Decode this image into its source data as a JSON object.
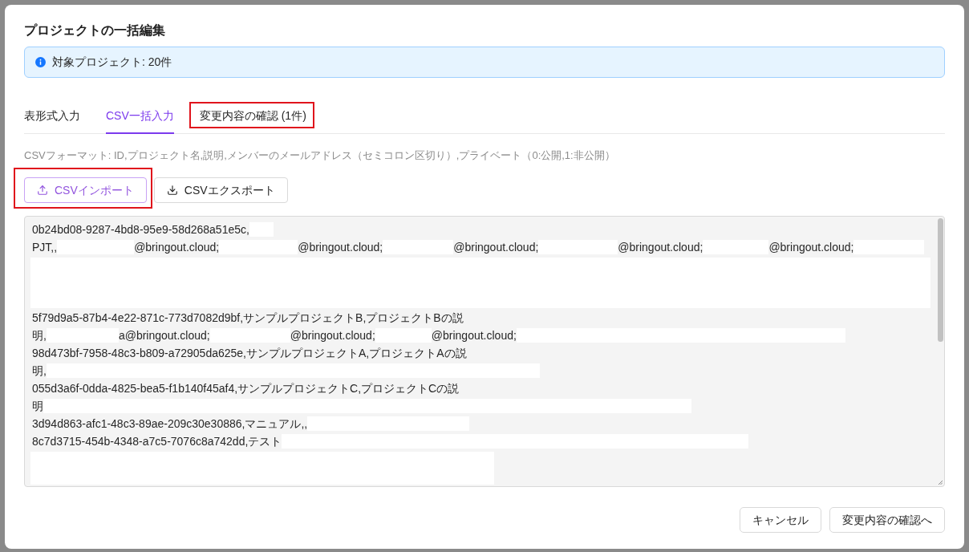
{
  "dialog": {
    "title": "プロジェクトの一括編集"
  },
  "alert": {
    "text": "対象プロジェクト: 20件"
  },
  "tabs": [
    {
      "label": "表形式入力",
      "selected": false,
      "highlighted": false
    },
    {
      "label": "CSV一括入力",
      "selected": true,
      "highlighted": false
    },
    {
      "label": "変更内容の確認 (1件)",
      "selected": false,
      "highlighted": true
    }
  ],
  "format_hint": "CSVフォーマット: ID,プロジェクト名,説明,メンバーのメールアドレス（セミコロン区切り）,プライベート（0:公開,1:非公開）",
  "toolbar_buttons": [
    {
      "label": "CSVインポート",
      "kind": "upload",
      "focused": true,
      "highlighted": true
    },
    {
      "label": "CSVエクスポート",
      "kind": "download",
      "focused": false,
      "highlighted": false
    }
  ],
  "csv_input": {
    "lines": [
      [
        {
          "kind": "text",
          "text": "0b24bd08-9287-4bd8-95e9-58d268a51e5c,"
        },
        {
          "kind": "redacted"
        }
      ],
      [
        {
          "kind": "text",
          "text": "PJT,,"
        },
        {
          "kind": "redacted"
        },
        {
          "kind": "text",
          "text": "@bringout.cloud;"
        },
        {
          "kind": "redacted"
        },
        {
          "kind": "text",
          "text": "@bringout.cloud;"
        },
        {
          "kind": "redacted"
        },
        {
          "kind": "text",
          "text": "@bringout.cloud;"
        },
        {
          "kind": "redacted"
        },
        {
          "kind": "text",
          "text": "@bringout.cloud;"
        },
        {
          "kind": "redacted"
        },
        {
          "kind": "text",
          "text": "@bringout.cloud;"
        },
        {
          "kind": "redacted"
        }
      ],
      [
        {
          "kind": "redacted_block"
        }
      ],
      [
        {
          "kind": "text",
          "text": "5f79d9a5-87b4-4e22-871c-773d7082d9bf,サンプルプロジェクトB,プロジェクトBの説"
        }
      ],
      [
        {
          "kind": "text",
          "text": "明,"
        },
        {
          "kind": "redacted"
        },
        {
          "kind": "text",
          "text": "a@bringout.cloud;"
        },
        {
          "kind": "redacted"
        },
        {
          "kind": "text",
          "text": "@bringout.cloud;"
        },
        {
          "kind": "redacted"
        },
        {
          "kind": "text",
          "text": "@bringout.cloud;"
        },
        {
          "kind": "redacted"
        }
      ],
      [
        {
          "kind": "text",
          "text": "98d473bf-7958-48c3-b809-a72905da625e,サンプルプロジェクトA,プロジェクトAの説"
        }
      ],
      [
        {
          "kind": "text",
          "text": "明,"
        },
        {
          "kind": "redacted"
        }
      ],
      [
        {
          "kind": "text",
          "text": "055d3a6f-0dda-4825-bea5-f1b140f45af4,サンプルプロジェクトC,プロジェクトCの説"
        }
      ],
      [
        {
          "kind": "text",
          "text": "明"
        },
        {
          "kind": "redacted"
        }
      ],
      [
        {
          "kind": "text",
          "text": "3d94d863-afc1-48c3-89ae-209c30e30886,マニュアル,,"
        },
        {
          "kind": "redacted"
        }
      ],
      [
        {
          "kind": "text",
          "text": "8c7d3715-454b-4348-a7c5-7076c8a742dd,テスト"
        },
        {
          "kind": "redacted"
        }
      ],
      [
        {
          "kind": "redacted_block"
        }
      ]
    ]
  },
  "footer_buttons": [
    {
      "label": "キャンセル"
    },
    {
      "label": "変更内容の確認へ"
    }
  ]
}
